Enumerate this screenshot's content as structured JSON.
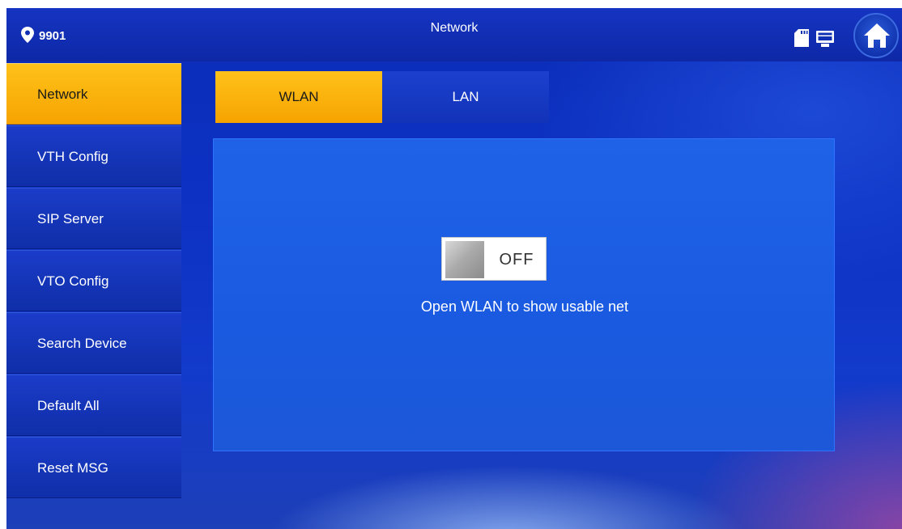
{
  "header": {
    "room_number": "9901",
    "title": "Network",
    "icons": [
      "location-pin-icon",
      "sd-card-icon",
      "monitor-icon",
      "home-icon"
    ]
  },
  "sidebar": {
    "items": [
      {
        "label": "Network",
        "active": true
      },
      {
        "label": "VTH Config",
        "active": false
      },
      {
        "label": "SIP Server",
        "active": false
      },
      {
        "label": "VTO Config",
        "active": false
      },
      {
        "label": "Search Device",
        "active": false
      },
      {
        "label": "Default All",
        "active": false
      },
      {
        "label": "Reset MSG",
        "active": false
      }
    ]
  },
  "tabs": {
    "items": [
      {
        "label": "WLAN",
        "active": true
      },
      {
        "label": "LAN",
        "active": false
      }
    ]
  },
  "wlan": {
    "toggle_state": "OFF",
    "hint": "Open WLAN to show usable net"
  },
  "colors": {
    "accent": "#f6a300",
    "background": "#0d32c4",
    "panel": "#1f62e8"
  }
}
